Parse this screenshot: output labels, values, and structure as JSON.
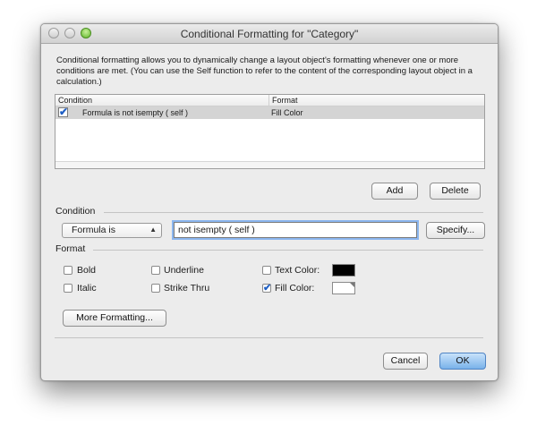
{
  "window": {
    "title": "Conditional Formatting for \"Category\""
  },
  "description": "Conditional formatting allows you to dynamically change a layout object's formatting whenever one or more conditions are met.  (You can use the Self function to refer to the content of the corresponding layout object in a calculation.)",
  "table": {
    "headers": [
      "Condition",
      "Format"
    ],
    "rows": [
      {
        "checked": true,
        "condition": "Formula is not isempty ( self )",
        "format": "Fill Color"
      }
    ]
  },
  "buttons": {
    "add": "Add",
    "delete": "Delete",
    "specify": "Specify...",
    "more_formatting": "More Formatting...",
    "cancel": "Cancel",
    "ok": "OK"
  },
  "condition": {
    "section_label": "Condition",
    "type_selected": "Formula is",
    "formula_value": "not isempty ( self )"
  },
  "format": {
    "section_label": "Format",
    "options": {
      "bold": {
        "label": "Bold",
        "checked": false
      },
      "italic": {
        "label": "Italic",
        "checked": false
      },
      "underline": {
        "label": "Underline",
        "checked": false
      },
      "strike_thru": {
        "label": "Strike Thru",
        "checked": false
      },
      "text_color": {
        "label": "Text Color:",
        "checked": false,
        "color": "#000000"
      },
      "fill_color": {
        "label": "Fill Color:",
        "checked": true,
        "color": "#ffffff"
      }
    }
  },
  "colors": {
    "accent": "#1f5fc4",
    "focus_ring": "#8bb6ef",
    "selected_row": "#d4d4d4"
  }
}
